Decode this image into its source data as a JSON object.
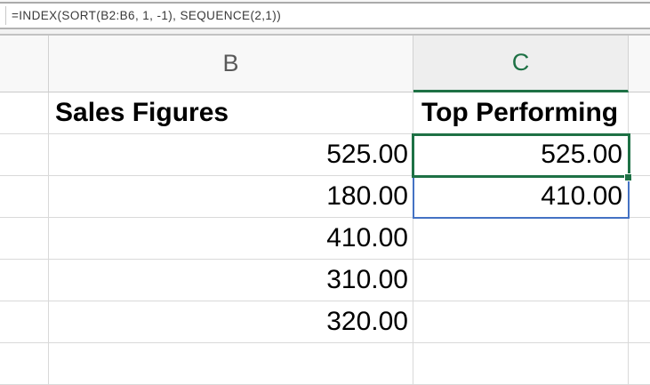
{
  "formula_bar": {
    "formula": "=INDEX(SORT(B2:B6, 1, -1), SEQUENCE(2,1))"
  },
  "column_headers": {
    "a": "",
    "b": "B",
    "c": "C",
    "d": ""
  },
  "grid": {
    "rows": [
      {
        "a": "",
        "b": "Sales Figures",
        "c": "Top Performing",
        "d": ""
      },
      {
        "a": "",
        "b": "525.00",
        "c": "525.00",
        "d": ""
      },
      {
        "a": "",
        "b": "180.00",
        "c": "410.00",
        "d": ""
      },
      {
        "a": "",
        "b": "410.00",
        "c": "",
        "d": ""
      },
      {
        "a": "",
        "b": "310.00",
        "c": "",
        "d": ""
      },
      {
        "a": "",
        "b": "320.00",
        "c": "",
        "d": ""
      },
      {
        "a": "",
        "b": "",
        "c": "",
        "d": ""
      }
    ]
  },
  "colors": {
    "accent_green": "#1E7145",
    "spill_blue": "#4472C4"
  }
}
